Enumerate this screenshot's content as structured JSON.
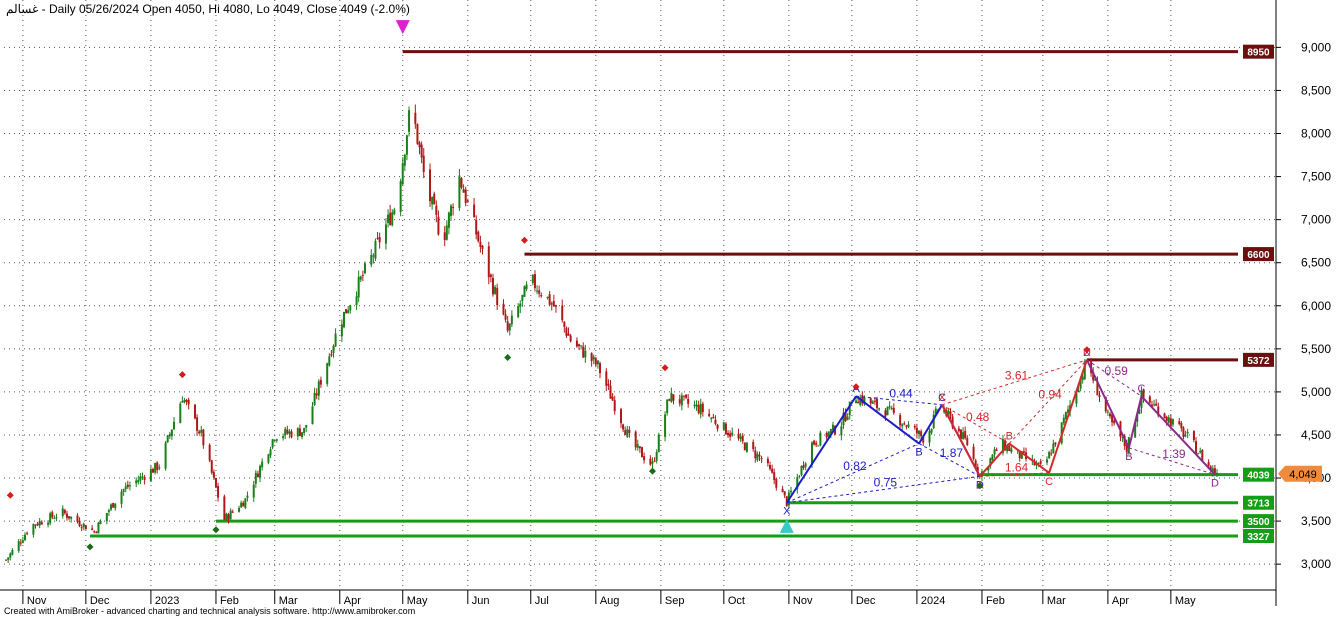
{
  "header": {
    "symbol": "غسالم",
    "summary": "- Daily 05/26/2024 Open 4050, Hi 4080, Lo 4049, Close 4049 (-2.0%)"
  },
  "footer": {
    "credit": "Created with AmiBroker - advanced charting and technical analysis software. http://www.amibroker.com"
  },
  "colors": {
    "up": "#1a7f1a",
    "down": "#b01818",
    "resistance": "#6b0f0f",
    "support": "#159e15",
    "pattern_blue": "#1c1cc8",
    "pattern_red": "#d22a2a",
    "pattern_purple": "#8a2a8a",
    "last_price_badge": "#f08a3c",
    "top_marker": "#e020d0",
    "bottom_marker": "#38c8c8"
  },
  "chart_data": {
    "type": "candlestick",
    "title": "",
    "ylim": [
      2700,
      9550
    ],
    "y_ticks": [
      "3,000",
      "3,500",
      "4,000",
      "4,500",
      "5,000",
      "5,500",
      "6,000",
      "6,500",
      "7,000",
      "7,500",
      "8,000",
      "8,500",
      "9,000"
    ],
    "x_ticks": [
      {
        "label": "Nov",
        "date": "2022-11-01"
      },
      {
        "label": "Dec",
        "date": "2022-12-01"
      },
      {
        "label": "2023",
        "date": "2023-01-01"
      },
      {
        "label": "Feb",
        "date": "2023-02-01"
      },
      {
        "label": "Mar",
        "date": "2023-03-01"
      },
      {
        "label": "Apr",
        "date": "2023-04-01"
      },
      {
        "label": "May",
        "date": "2023-05-01"
      },
      {
        "label": "Jun",
        "date": "2023-06-01"
      },
      {
        "label": "Jul",
        "date": "2023-07-01"
      },
      {
        "label": "Aug",
        "date": "2023-08-01"
      },
      {
        "label": "Sep",
        "date": "2023-09-01"
      },
      {
        "label": "Oct",
        "date": "2023-10-01"
      },
      {
        "label": "Nov",
        "date": "2023-11-01"
      },
      {
        "label": "Dec",
        "date": "2023-12-01"
      },
      {
        "label": "2024",
        "date": "2024-01-01"
      },
      {
        "label": "Feb",
        "date": "2024-02-01"
      },
      {
        "label": "Mar",
        "date": "2024-03-01"
      },
      {
        "label": "Apr",
        "date": "2024-04-01"
      },
      {
        "label": "May",
        "date": "2024-05-01"
      }
    ],
    "date_range": [
      "2022-10-23",
      "2024-06-02"
    ],
    "price_path": [
      {
        "date": "2022-10-24",
        "close": 3050
      },
      {
        "date": "2022-11-05",
        "close": 3450
      },
      {
        "date": "2022-11-20",
        "close": 3600
      },
      {
        "date": "2022-12-05",
        "close": 3380
      },
      {
        "date": "2022-12-18",
        "close": 3850
      },
      {
        "date": "2023-01-05",
        "close": 4150
      },
      {
        "date": "2023-01-16",
        "close": 4950
      },
      {
        "date": "2023-01-25",
        "close": 4500
      },
      {
        "date": "2023-02-05",
        "close": 3520
      },
      {
        "date": "2023-02-15",
        "close": 3750
      },
      {
        "date": "2023-03-01",
        "close": 4500
      },
      {
        "date": "2023-03-15",
        "close": 4550
      },
      {
        "date": "2023-04-01",
        "close": 5800
      },
      {
        "date": "2023-04-15",
        "close": 6500
      },
      {
        "date": "2023-04-28",
        "close": 7200
      },
      {
        "date": "2023-05-05",
        "close": 8350
      },
      {
        "date": "2023-05-12",
        "close": 7400
      },
      {
        "date": "2023-05-20",
        "close": 6750
      },
      {
        "date": "2023-05-28",
        "close": 7500
      },
      {
        "date": "2023-06-08",
        "close": 6600
      },
      {
        "date": "2023-06-20",
        "close": 5700
      },
      {
        "date": "2023-07-01",
        "close": 6300
      },
      {
        "date": "2023-07-12",
        "close": 6000
      },
      {
        "date": "2023-07-20",
        "close": 5600
      },
      {
        "date": "2023-08-02",
        "close": 5300
      },
      {
        "date": "2023-08-18",
        "close": 4400
      },
      {
        "date": "2023-08-28",
        "close": 4150
      },
      {
        "date": "2023-09-05",
        "close": 4950
      },
      {
        "date": "2023-09-20",
        "close": 4800
      },
      {
        "date": "2023-10-05",
        "close": 4500
      },
      {
        "date": "2023-10-20",
        "close": 4200
      },
      {
        "date": "2023-10-31",
        "close": 3720
      },
      {
        "date": "2023-11-12",
        "close": 4400
      },
      {
        "date": "2023-11-25",
        "close": 4600
      },
      {
        "date": "2023-12-03",
        "close": 4950
      },
      {
        "date": "2023-12-20",
        "close": 4750
      },
      {
        "date": "2024-01-05",
        "close": 4450
      },
      {
        "date": "2024-01-12",
        "close": 4850
      },
      {
        "date": "2024-01-25",
        "close": 4400
      },
      {
        "date": "2024-01-31",
        "close": 4030
      },
      {
        "date": "2024-02-10",
        "close": 4400
      },
      {
        "date": "2024-02-20",
        "close": 4250
      },
      {
        "date": "2024-03-01",
        "close": 4100
      },
      {
        "date": "2024-03-10",
        "close": 4600
      },
      {
        "date": "2024-03-22",
        "close": 5350
      },
      {
        "date": "2024-04-01",
        "close": 4700
      },
      {
        "date": "2024-04-10",
        "close": 4350
      },
      {
        "date": "2024-04-17",
        "close": 4950
      },
      {
        "date": "2024-04-25",
        "close": 4800
      },
      {
        "date": "2024-05-10",
        "close": 4450
      },
      {
        "date": "2024-05-20",
        "close": 4100
      },
      {
        "date": "2024-05-26",
        "close": 4049
      }
    ],
    "last_price": "4,049",
    "levels": [
      {
        "label": "8950",
        "value": 8950,
        "kind": "resistance",
        "start": "2023-05-01"
      },
      {
        "label": "6600",
        "value": 6600,
        "kind": "resistance",
        "start": "2023-06-28"
      },
      {
        "label": "5372",
        "value": 5372,
        "kind": "resistance",
        "start": "2024-03-22"
      },
      {
        "label": "4039",
        "value": 4039,
        "kind": "support",
        "start": "2024-01-31"
      },
      {
        "label": "3713",
        "value": 3713,
        "kind": "support",
        "start": "2023-10-31"
      },
      {
        "label": "3500",
        "value": 3500,
        "kind": "support",
        "start": "2023-02-01"
      },
      {
        "label": "3327",
        "value": 3327,
        "kind": "support",
        "start": "2022-12-03"
      }
    ],
    "patterns": [
      {
        "name": "blue",
        "points": [
          {
            "label": "X",
            "date": "2023-10-31",
            "value": 3713
          },
          {
            "label": "A",
            "date": "2023-12-03",
            "value": 4950
          },
          {
            "label": "B",
            "date": "2024-01-02",
            "value": 4400
          },
          {
            "label": "C",
            "date": "2024-01-13",
            "value": 4850
          },
          {
            "label": "D",
            "date": "2024-01-31",
            "value": 4020
          }
        ],
        "ratios": [
          "0.82",
          "1.87",
          "0.44",
          "0.75"
        ]
      },
      {
        "name": "red",
        "points": [
          {
            "label": "X",
            "date": "2024-01-13",
            "value": 4850
          },
          {
            "label": "A",
            "date": "2024-01-31",
            "value": 4020
          },
          {
            "label": "B",
            "date": "2024-02-14",
            "value": 4400
          },
          {
            "label": "C",
            "date": "2024-03-04",
            "value": 4060
          },
          {
            "label": "D",
            "date": "2024-03-22",
            "value": 5372
          }
        ],
        "ratios": [
          "0.48",
          "0.94",
          "1.64",
          "3.61"
        ]
      },
      {
        "name": "purple",
        "points": [
          {
            "label": "X",
            "date": "2024-03-22",
            "value": 5372
          },
          {
            "label": "B",
            "date": "2024-04-11",
            "value": 4350
          },
          {
            "label": "C",
            "date": "2024-04-17",
            "value": 4950
          },
          {
            "label": "D",
            "date": "2024-05-22",
            "value": 4040
          }
        ],
        "ratios": [
          "0.59",
          "1.39"
        ]
      }
    ],
    "swing_markers": [
      {
        "date": "2022-10-26",
        "value": 3800,
        "kind": "high"
      },
      {
        "date": "2022-12-03",
        "value": 3200,
        "kind": "low"
      },
      {
        "date": "2023-01-16",
        "value": 5200,
        "kind": "high"
      },
      {
        "date": "2023-02-01",
        "value": 3400,
        "kind": "low"
      },
      {
        "date": "2023-06-20",
        "value": 5400,
        "kind": "low"
      },
      {
        "date": "2023-06-28",
        "value": 6760,
        "kind": "high"
      },
      {
        "date": "2023-08-28",
        "value": 4080,
        "kind": "low"
      },
      {
        "date": "2023-09-03",
        "value": 5280,
        "kind": "high"
      },
      {
        "date": "2023-12-03",
        "value": 5060,
        "kind": "high"
      },
      {
        "date": "2024-01-31",
        "value": 3910,
        "kind": "low"
      },
      {
        "date": "2024-03-22",
        "value": 5490,
        "kind": "high"
      }
    ],
    "major_markers": [
      {
        "date": "2023-05-01",
        "value": 9200,
        "kind": "top"
      },
      {
        "date": "2023-10-31",
        "value": 3480,
        "kind": "bottom"
      }
    ]
  }
}
